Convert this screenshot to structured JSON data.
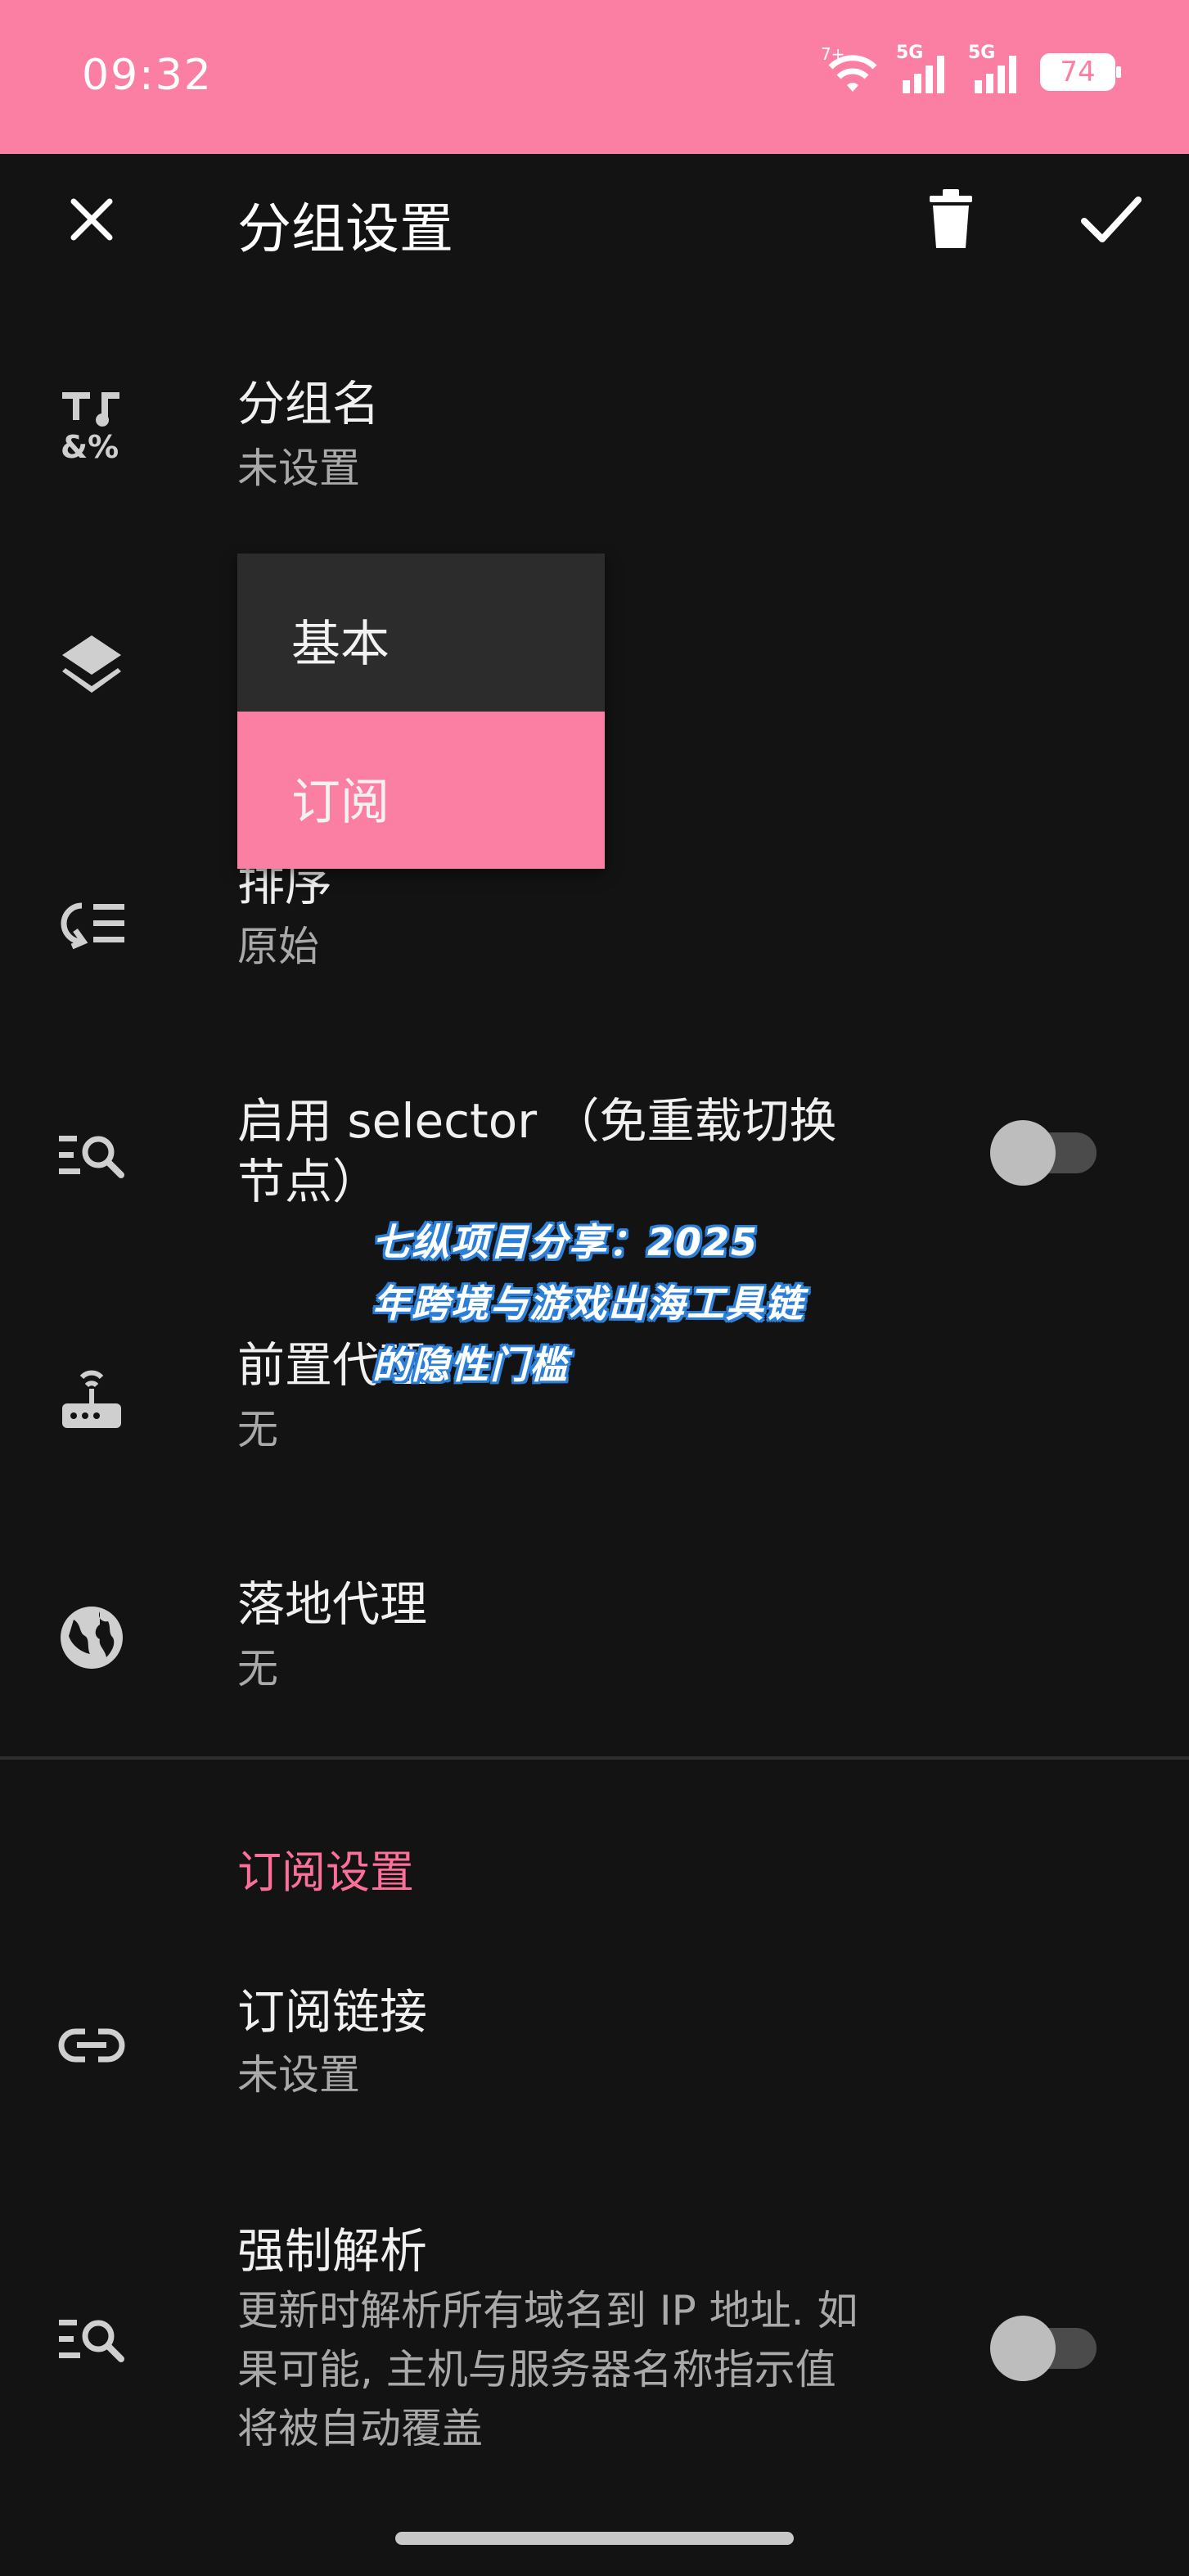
{
  "status_bar": {
    "time": "09:32",
    "wifi_label": "7+",
    "sim1_label": "5G",
    "sim2_label": "5G",
    "battery": "74"
  },
  "app_bar": {
    "title": "分组设置",
    "close_icon": "close-icon",
    "delete_icon": "trash-icon",
    "confirm_icon": "check-icon",
    "background": "#fb7ea3"
  },
  "settings": {
    "group_name": {
      "title": "分组名",
      "value": "未设置",
      "icon": "text-format-icon"
    },
    "group_type": {
      "icon": "layers-icon"
    },
    "sort": {
      "title": "排序",
      "value": "原始",
      "icon": "sort-icon"
    },
    "selector": {
      "title_line1": "启用 selector （免重载切换",
      "title_line2": "节点）",
      "icon": "search-list-icon",
      "enabled": false
    },
    "front_proxy": {
      "title": "前置代理",
      "value": "无",
      "icon": "router-icon"
    },
    "landing_proxy": {
      "title": "落地代理",
      "value": "无",
      "icon": "globe-icon"
    }
  },
  "type_dropdown": {
    "options": [
      "基本",
      "订阅"
    ],
    "selected": "订阅",
    "highlight_color": "#fb7ea3"
  },
  "subscription_section": {
    "header": "订阅设置",
    "header_color": "#fb6f98",
    "link": {
      "title": "订阅链接",
      "value": "未设置",
      "icon": "link-icon"
    },
    "force_resolve": {
      "title": "强制解析",
      "desc_line1": "更新时解析所有域名到 IP 地址. 如",
      "desc_line2": "果可能, 主机与服务器名称指示值",
      "desc_line3": "将被自动覆盖",
      "icon": "search-list-icon",
      "enabled": false
    }
  },
  "watermark": {
    "line1": "七纵项目分享：2025",
    "line2": "年跨境与游戏出海工具链",
    "line3": "的隐性门槛"
  }
}
